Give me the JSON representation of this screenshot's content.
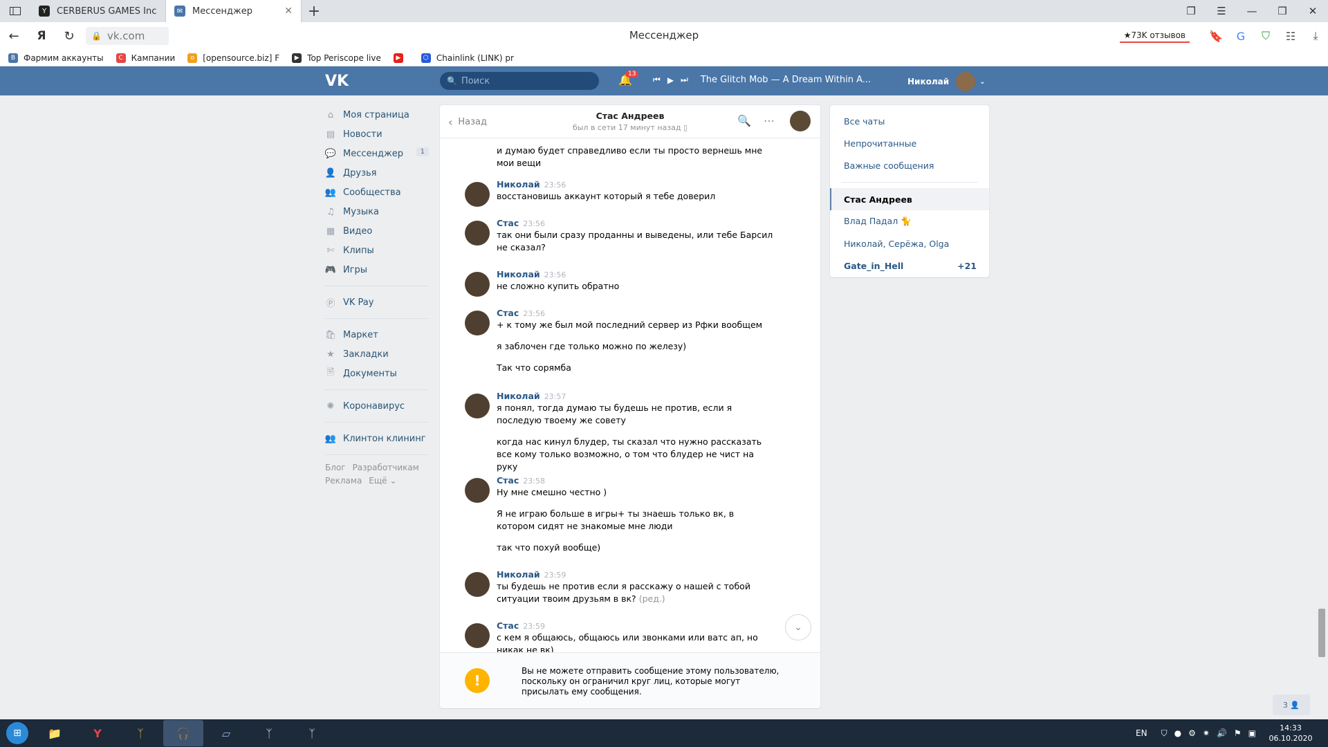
{
  "browser": {
    "tabs": [
      {
        "label": "CERBERUS GAMES Inc",
        "active": false
      },
      {
        "label": "Мессенджер",
        "active": true
      }
    ],
    "url": "vk.com",
    "page_title": "Мессенджер",
    "reviews": "★73K отзывов",
    "bookmarks": [
      {
        "label": "Фармим аккаунты"
      },
      {
        "label": "Кампании"
      },
      {
        "label": "[opensource.biz] F"
      },
      {
        "label": "Top Periscope live"
      },
      {
        "label": ""
      },
      {
        "label": "Chainlink (LINK) pr"
      }
    ]
  },
  "vk": {
    "logo": "VK",
    "search_placeholder": "Поиск",
    "notifications": "13",
    "track": "The Glitch Mob — A Dream Within A...",
    "user_name": "Николай"
  },
  "left_menu": {
    "items": [
      {
        "label": "Моя страница",
        "icon": "home-icon"
      },
      {
        "label": "Новости",
        "icon": "news-icon"
      },
      {
        "label": "Мессенджер",
        "icon": "messages-icon",
        "count": "1"
      },
      {
        "label": "Друзья",
        "icon": "friends-icon"
      },
      {
        "label": "Сообщества",
        "icon": "groups-icon"
      },
      {
        "label": "Музыка",
        "icon": "music-icon"
      },
      {
        "label": "Видео",
        "icon": "video-icon"
      },
      {
        "label": "Клипы",
        "icon": "clips-icon"
      },
      {
        "label": "Игры",
        "icon": "games-icon"
      }
    ],
    "items2": [
      {
        "label": "VK Pay",
        "icon": "vkpay-icon"
      }
    ],
    "items3": [
      {
        "label": "Маркет",
        "icon": "market-icon"
      },
      {
        "label": "Закладки",
        "icon": "bookmarks-icon"
      },
      {
        "label": "Документы",
        "icon": "documents-icon"
      }
    ],
    "items4": [
      {
        "label": "Коронавирус",
        "icon": "coronavirus-icon"
      }
    ],
    "items5": [
      {
        "label": "Клинтон клининг",
        "icon": "group-icon"
      }
    ],
    "footer": {
      "blog": "Блог",
      "dev": "Разработчикам",
      "ads": "Реклама",
      "more": "Ещё ⌄"
    }
  },
  "chat": {
    "back_label": "Назад",
    "peer_name": "Стас Андреев",
    "peer_status": "был в сети 17 минут назад",
    "top_fragment": "и думаю будет справедливо если ты просто вернешь мне мои вещи",
    "messages": [
      {
        "author": "Николай",
        "time": "23:56",
        "texts": [
          "восстановишь аккаунт который я тебе доверил"
        ]
      },
      {
        "author": "Стас",
        "time": "23:56",
        "texts": [
          "так они были сразу проданны и выведены, или тебе Барсил не сказал?"
        ]
      },
      {
        "author": "Николай",
        "time": "23:56",
        "texts": [
          "не сложно купить обратно"
        ]
      },
      {
        "author": "Стас",
        "time": "23:56",
        "texts": [
          "+ к тому же был мой последний сервер из Рфки вообщем",
          "я заблочен где только можно по железу)",
          "Так что сорямба"
        ]
      },
      {
        "author": "Николай",
        "time": "23:57",
        "texts": [
          "я понял, тогда думаю ты будешь не против, если я последую твоему же совету",
          "когда нас кинул блудер, ты сказал что нужно рассказать все кому только возможно, о том что блудер не чист на руку"
        ]
      },
      {
        "author": "Стас",
        "time": "23:58",
        "texts": [
          "Ну мне смешно честно )",
          "Я не играю больше в игры+ ты знаешь только вк, в котором сидят не знакомые мне люди",
          "так что похуй вообще)"
        ]
      },
      {
        "author": "Николай",
        "time": "23:59",
        "texts": [
          "ты будешь не против если я расскажу о нашей с тобой ситуации твоим друзьям в вк?"
        ],
        "edited": "(ред.)"
      },
      {
        "author": "Стас",
        "time": "23:59",
        "texts": [
          "с кем я общаюсь, общаюсь или звонками или ватс ап, но никак не вк)"
        ]
      }
    ],
    "warning": "Вы не можете отправить сообщение этому пользователю, поскольку он ограничил круг лиц, которые могут присылать ему сообщения."
  },
  "chat_list": {
    "filters": [
      "Все чаты",
      "Непрочитанные",
      "Важные сообщения"
    ],
    "chats": [
      {
        "label": "Стас Андреев",
        "active": true
      },
      {
        "label": "Влад Падал 🐈"
      },
      {
        "label": "Николай, Серёжа, Olga"
      },
      {
        "label": "Gate_in_Hell",
        "count": "+21"
      }
    ]
  },
  "online_count": "3 👤",
  "taskbar": {
    "lang": "EN",
    "time": "14:33",
    "date": "06.10.2020"
  }
}
